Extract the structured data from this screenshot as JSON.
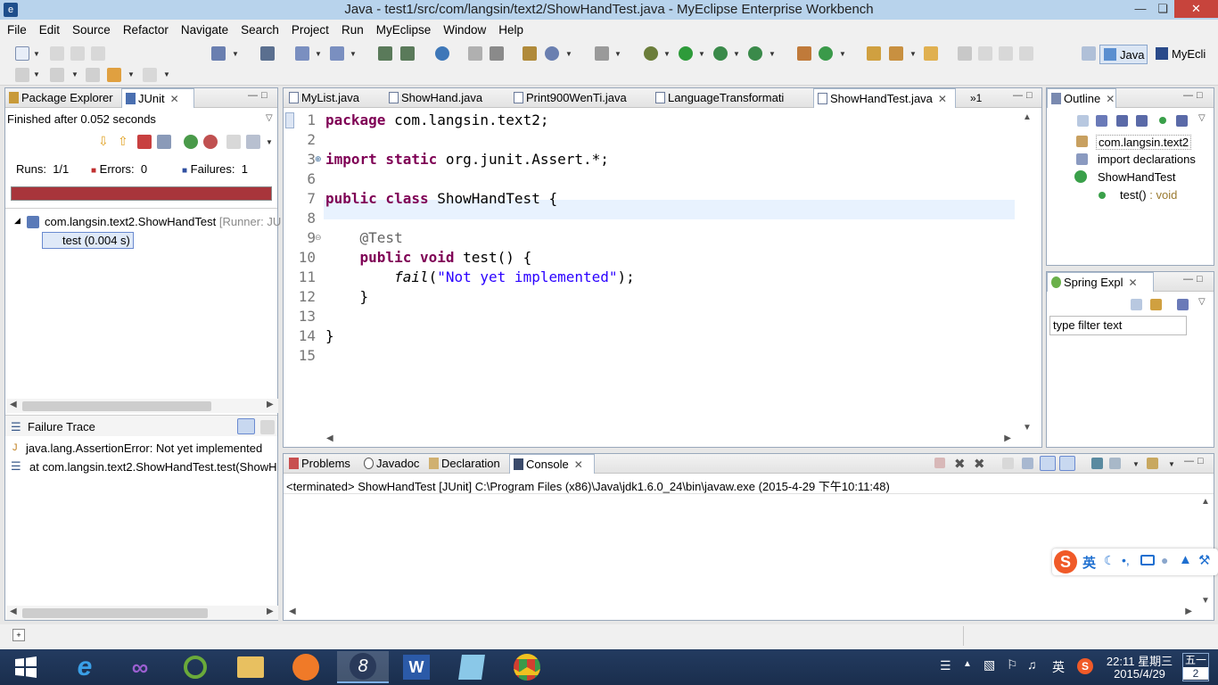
{
  "window": {
    "title": "Java - test1/src/com/langsin/text2/ShowHandTest.java - MyEclipse Enterprise Workbench",
    "min_icon": "minimize-icon",
    "restore_icon": "restore-icon",
    "close_icon": "close-icon"
  },
  "menu": [
    "File",
    "Edit",
    "Source",
    "Refactor",
    "Navigate",
    "Search",
    "Project",
    "Run",
    "MyEclipse",
    "Window",
    "Help"
  ],
  "perspectives": {
    "java": "Java",
    "myeclipse": "MyEcli"
  },
  "left_panel": {
    "tabs": [
      "Package Explorer",
      "JUnit"
    ],
    "status": "Finished after 0.052 seconds",
    "runs_label": "Runs:",
    "runs_value": "1/1",
    "errors_label": "Errors:",
    "errors_value": "0",
    "failures_label": "Failures:",
    "failures_value": "1",
    "bar_color": "#a8353b",
    "tree_root": "com.langsin.text2.ShowHandTest",
    "tree_root_suffix": "[Runner: JU",
    "tree_child": "test (0.004 s)",
    "failure_trace_title": "Failure Trace",
    "trace_lines": [
      "java.lang.AssertionError: Not yet implemented",
      "at com.langsin.text2.ShowHandTest.test(ShowHa"
    ]
  },
  "editor": {
    "tabs": [
      "MyList.java",
      "ShowHand.java",
      "Print900WenTi.java",
      "LanguageTransformati",
      "ShowHandTest.java"
    ],
    "overflow": "»1",
    "active_tab": "ShowHandTest.java",
    "line_numbers": [
      "1",
      "2",
      "3",
      "6",
      "7",
      "8",
      "9",
      "10",
      "11",
      "12",
      "13",
      "14",
      "15"
    ],
    "code": {
      "l1_kw": "package",
      "l1_rest": " com.langsin.text2;",
      "l3_kw": "import static",
      "l3_rest": " org.junit.Assert.*;",
      "l7_kw": "public class",
      "l7_rest": " ShowHandTest {",
      "l9": "    @Test",
      "l10_kw": "    public void",
      "l10_rest": " test() {",
      "l11_pre": "        ",
      "l11_fn": "fail",
      "l11_open": "(",
      "l11_str": "\"Not yet implemented\"",
      "l11_close": ");",
      "l12": "    }",
      "l14": "}"
    }
  },
  "outline": {
    "title": "Outline",
    "items": [
      "com.langsin.text2",
      "import declarations",
      "ShowHandTest",
      "test()"
    ],
    "method_type": ": void"
  },
  "spring": {
    "title": "Spring Expl",
    "filter_placeholder": "type filter text"
  },
  "console": {
    "tabs": [
      "Problems",
      "Javadoc",
      "Declaration",
      "Console"
    ],
    "active_tab": "Console",
    "status_line": "<terminated> ShowHandTest [JUnit] C:\\Program Files (x86)\\Java\\jdk1.6.0_24\\bin\\javaw.exe (2015-4-29 下午10:11:48)"
  },
  "ime": {
    "mode": "英"
  },
  "taskbar": {
    "tray_ime": "英",
    "time": "22:11 星期三",
    "date": "2015/4/29",
    "day_top": "五一",
    "day_bottom": "2"
  }
}
